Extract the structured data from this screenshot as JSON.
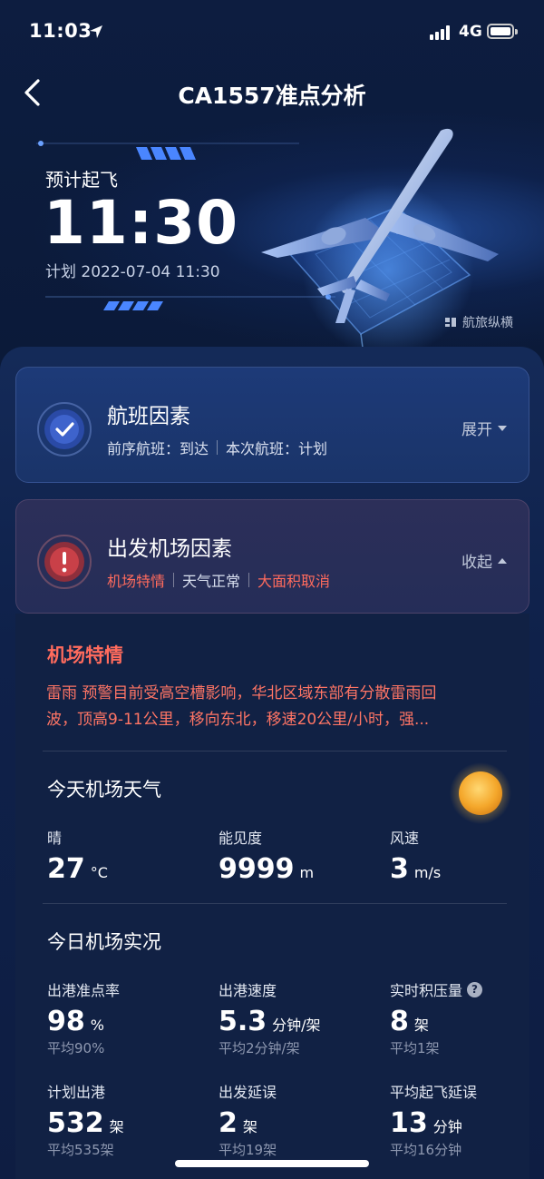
{
  "status_bar": {
    "time": "11:03",
    "network": "4G"
  },
  "nav": {
    "title": "CA1557准点分析"
  },
  "hero": {
    "label": "预计起飞",
    "time": "11:30",
    "plan": "计划 2022-07-04 11:30",
    "brand": "航旅纵横"
  },
  "flight_card": {
    "title": "航班因素",
    "sub": [
      "前序航班：到达",
      "本次航班：计划"
    ],
    "toggle": "展开"
  },
  "airport_card": {
    "title": "出发机场因素",
    "sub": [
      "机场特情",
      "天气正常",
      "大面积取消"
    ],
    "toggle": "收起"
  },
  "special": {
    "title": "机场特情",
    "lines": [
      "雷雨  预警目前受高空槽影响，华北区域东部有分散雷雨回",
      "波，顶高9-11公里，移向东北，移速20公里/小时，强..."
    ]
  },
  "weather": {
    "title": "今天机场天气",
    "icon": "sun-icon",
    "items": [
      {
        "label": "晴",
        "value": "27",
        "unit": "°C"
      },
      {
        "label": "能见度",
        "value": "9999",
        "unit": "m"
      },
      {
        "label": "风速",
        "value": "3",
        "unit": "m/s"
      }
    ]
  },
  "live": {
    "title": "今日机场实况",
    "items": [
      {
        "label": "出港准点率",
        "value": "98",
        "unit": "%",
        "avg": "平均90%"
      },
      {
        "label": "出港速度",
        "value": "5.3",
        "unit": "分钟/架",
        "avg": "平均2分钟/架"
      },
      {
        "label": "实时积压量",
        "value": "8",
        "unit": "架",
        "avg": "平均1架",
        "help": "?"
      },
      {
        "label": "计划出港",
        "value": "532",
        "unit": "架",
        "avg": "平均535架"
      },
      {
        "label": "出发延误",
        "value": "2",
        "unit": "架",
        "avg": "平均19架"
      },
      {
        "label": "平均起飞延误",
        "value": "13",
        "unit": "分钟",
        "avg": "平均16分钟"
      }
    ]
  },
  "colors": {
    "warn": "#ff6b5d",
    "accent": "#3c7bff",
    "panel": "#142a58"
  }
}
